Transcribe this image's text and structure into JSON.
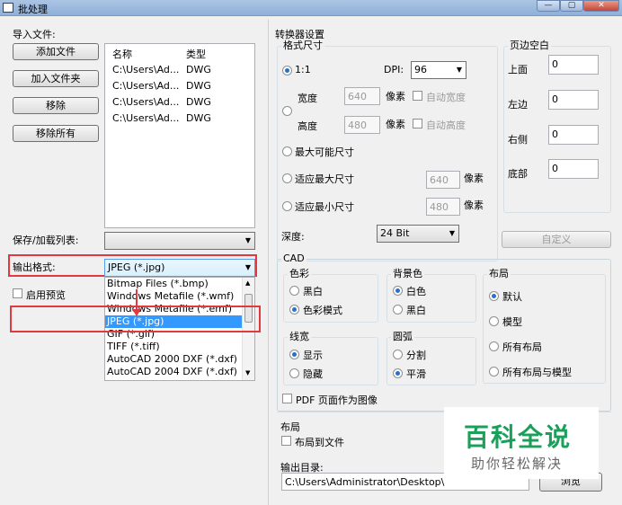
{
  "window": {
    "title": "批处理",
    "min": "—",
    "max": "▢",
    "close": "✕"
  },
  "import": {
    "label": "导入文件:",
    "add_file": "添加文件",
    "add_folder": "加入文件夹",
    "remove": "移除",
    "remove_all": "移除所有",
    "col_name": "名称",
    "col_type": "类型",
    "files": [
      {
        "name": "C:\\Users\\Ad...",
        "type": "DWG"
      },
      {
        "name": "C:\\Users\\Ad...",
        "type": "DWG"
      },
      {
        "name": "C:\\Users\\Ad...",
        "type": "DWG"
      },
      {
        "name": "C:\\Users\\Ad...",
        "type": "DWG"
      }
    ]
  },
  "save_list": {
    "label": "保存/加载列表:",
    "value": ""
  },
  "output_format": {
    "label": "输出格式:",
    "value": "JPEG (*.jpg)",
    "options": [
      "Bitmap Files (*.bmp)",
      "Windows Metafile (*.wmf)",
      "Windows Metafile (*.emf)",
      "JPEG (*.jpg)",
      "GIF (*.gif)",
      "TIFF (*.tiff)",
      "AutoCAD 2000 DXF (*.dxf)",
      "AutoCAD 2004 DXF (*.dxf)"
    ],
    "selected_index": 3
  },
  "preview": {
    "label": "启用预览"
  },
  "converter": {
    "label": "转换器设置",
    "format_size": {
      "label": "格式尺寸",
      "ratio": "1:1",
      "dpi_label": "DPI:",
      "dpi_value": "96",
      "width_label": "宽度",
      "width_value": "640",
      "height_label": "高度",
      "height_value": "480",
      "pixel": "像素",
      "auto_width": "自动宽度",
      "auto_height": "自动高度",
      "max_size": "最大可能尺寸",
      "fit_max": "适应最大尺寸",
      "fit_max_value": "640",
      "fit_min": "适应最小尺寸",
      "fit_min_value": "480",
      "depth_label": "深度:",
      "depth_value": "24 Bit"
    },
    "margins": {
      "label": "页边空白",
      "top": "上面",
      "left": "左边",
      "right": "右侧",
      "bottom": "底部",
      "top_v": "0",
      "left_v": "0",
      "right_v": "0",
      "bottom_v": "0",
      "custom": "自定义"
    }
  },
  "cad": {
    "label": "CAD",
    "color": {
      "label": "色彩",
      "bw": "黑白",
      "color_mode": "色彩模式"
    },
    "bg": {
      "label": "背景色",
      "white": "白色",
      "black": "黑白"
    },
    "layout": {
      "label": "布局",
      "default": "默认",
      "model": "模型",
      "all_layouts": "所有布局",
      "all_layouts_model": "所有布局与模型"
    },
    "lineweight": {
      "label": "线宽",
      "show": "显示",
      "hide": "隐藏"
    },
    "arc": {
      "label": "圆弧",
      "split": "分割",
      "smooth": "平滑"
    },
    "pdf_as_image": "PDF 页面作为图像"
  },
  "layout2": {
    "label": "布局",
    "layout_to_file": "布局到文件"
  },
  "output_dir": {
    "label": "输出目录:",
    "value": "C:\\Users\\Administrator\\Desktop\\",
    "browse": "浏览"
  },
  "watermark": {
    "main": "百科全说",
    "sub": "助你轻松解决",
    "main_color": "#1aa05a"
  },
  "colors": {
    "highlight": "#3399ff",
    "annotation": "#e0393e"
  }
}
